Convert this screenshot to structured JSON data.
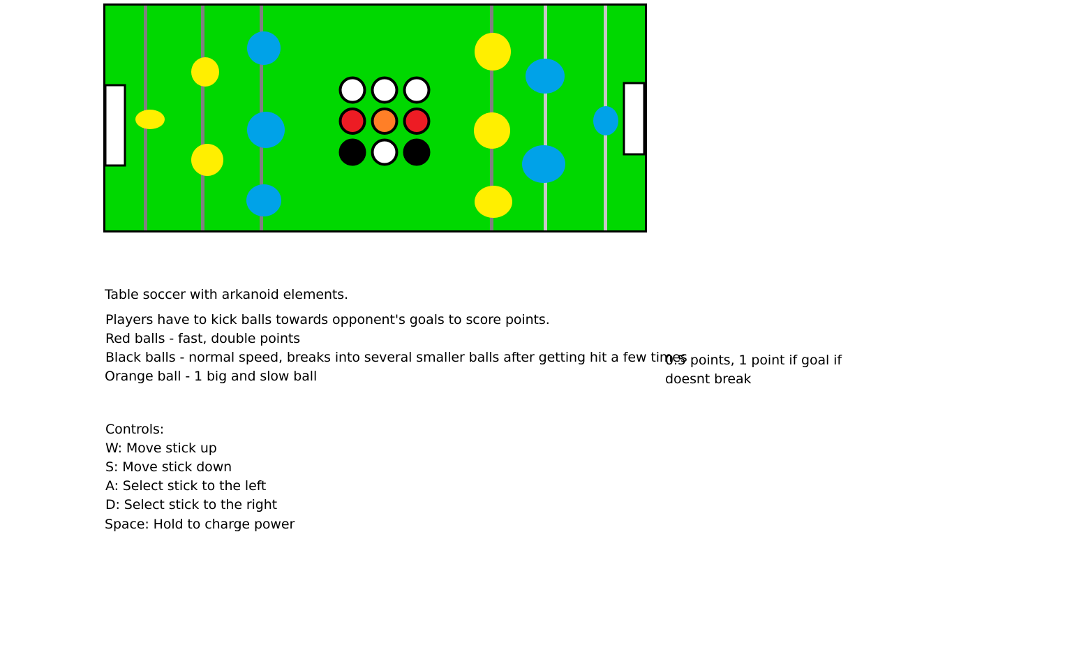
{
  "field": {
    "colors": {
      "grass": "#00d800",
      "border": "#000000",
      "rod_dark": "#808080",
      "rod_light": "#c0c0c0",
      "goal": "#ffffff",
      "team_left_goalie": "#ffef00",
      "team_yellow": "#ffef00",
      "team_blue": "#00a2e8",
      "ball_white": "#ffffff",
      "ball_red": "#ed1c24",
      "ball_orange": "#ff7f27",
      "ball_black": "#000000"
    },
    "ball_grid": [
      [
        "white",
        "white",
        "white"
      ],
      [
        "red",
        "orange",
        "red"
      ],
      [
        "black",
        "white",
        "black"
      ]
    ]
  },
  "text": {
    "title": "Table soccer with arkanoid elements.",
    "rules": [
      "Players have to kick balls towards opponent's goals to score points.",
      "Red balls - fast, double points",
      "Black balls - normal speed, breaks into several smaller balls after getting hit a few times",
      "Orange ball - 1 big and slow ball"
    ],
    "note": [
      "0.5 points, 1 point if goal if",
      "doesnt break"
    ],
    "controls_header": "Controls:",
    "controls": [
      "W: Move stick up",
      "S: Move stick down",
      "A: Select stick to the left",
      "D: Select stick to the right",
      "Space: Hold to charge power"
    ]
  }
}
